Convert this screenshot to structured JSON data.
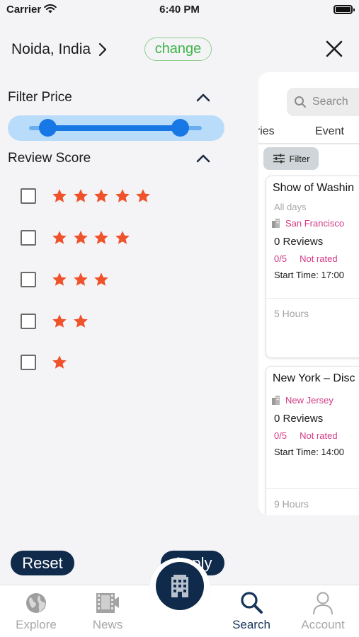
{
  "status_bar": {
    "carrier": "Carrier",
    "time": "6:40 PM"
  },
  "header": {
    "location": "Noida, India",
    "change_label": "change"
  },
  "filters": {
    "price_title": "Filter Price",
    "price_range": {
      "min_fraction": 0.0,
      "max_fraction": 1.0
    },
    "review_title": "Review Score",
    "review_options": [
      {
        "stars": 5,
        "checked": false
      },
      {
        "stars": 4,
        "checked": false
      },
      {
        "stars": 3,
        "checked": false
      },
      {
        "stars": 2,
        "checked": false
      },
      {
        "stars": 1,
        "checked": false
      }
    ],
    "reset_label": "Reset",
    "apply_label": "Apply"
  },
  "results": {
    "search_placeholder": "Search",
    "tabs": [
      "eries",
      "Event"
    ],
    "filter_label": "Filter",
    "cards": [
      {
        "title": "Show of Washin",
        "days": "All days",
        "location": "San Francisco",
        "reviews": "0 Reviews",
        "score": "0/5",
        "rating_text": "Not rated",
        "start_time": "Start Time: 17:00",
        "duration": "5 Hours"
      },
      {
        "title": "New York – Disc",
        "days": "",
        "location": "New Jersey",
        "reviews": "0 Reviews",
        "score": "0/5",
        "rating_text": "Not rated",
        "start_time": "Start Time: 14:00",
        "duration": "9 Hours"
      }
    ]
  },
  "tabbar": {
    "items": [
      {
        "label": "Explore",
        "icon": "globe-icon",
        "active": false
      },
      {
        "label": "News",
        "icon": "news-icon",
        "active": false
      },
      {
        "label": "Search",
        "icon": "search-icon",
        "active": true
      },
      {
        "label": "Account",
        "icon": "person-icon",
        "active": false
      }
    ],
    "center_icon": "hotel-icon"
  },
  "colors": {
    "navy": "#0f2a4a",
    "accent_blue": "#1677e5",
    "slider_bg": "#b8dcfa",
    "star": "#f0522c",
    "pink": "#d23a86",
    "green": "#3fb44a"
  }
}
